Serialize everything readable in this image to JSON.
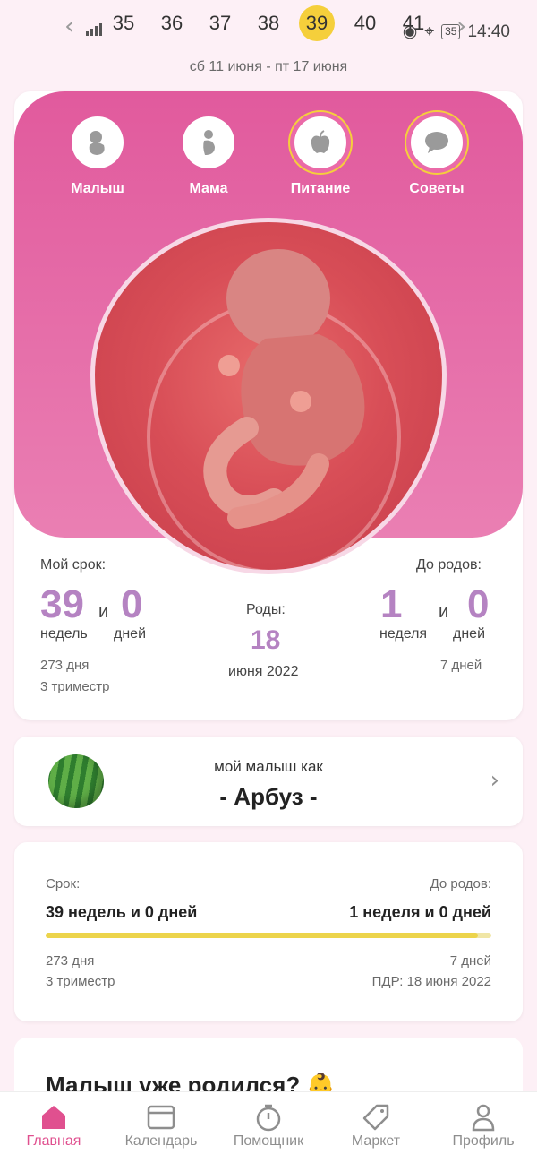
{
  "status_bar": {
    "time": "14:40",
    "battery": "35"
  },
  "week_selector": {
    "weeks": [
      "35",
      "36",
      "37",
      "38",
      "39",
      "40",
      "41"
    ],
    "active_week": "39",
    "date_range": "сб 11 июня - пт 17 июня"
  },
  "categories": [
    {
      "label": "Малыш",
      "icon": "baby-icon"
    },
    {
      "label": "Мама",
      "icon": "mom-icon"
    },
    {
      "label": "Питание",
      "icon": "apple-icon"
    },
    {
      "label": "Советы",
      "icon": "chat-icon"
    }
  ],
  "term": {
    "my_term_label": "Мой срок:",
    "weeks_value": "39",
    "and": "и",
    "days_value": "0",
    "weeks_unit": "недель",
    "days_unit": "дней",
    "total_days": "273 дня",
    "trimester": "3 триместр",
    "birth_label": "Роды:",
    "birth_day": "18",
    "birth_month": "июня 2022",
    "until_label": "До родов:",
    "until_weeks": "1",
    "until_and": "и",
    "until_days": "0",
    "until_weeks_unit": "неделя",
    "until_days_unit": "дней",
    "until_total": "7 дней"
  },
  "fruit": {
    "caption": "мой малыш как",
    "name": "- Арбуз -"
  },
  "summary": {
    "term_label": "Срок:",
    "term_value": "39 недель и 0 дней",
    "until_label": "До родов:",
    "until_value": "1 неделя и 0 дней",
    "progress": 0.97,
    "days": "273 дня",
    "trimester": "3 триместр",
    "days_left": "7 дней",
    "pdr": "ПДР: 18 июня 2022"
  },
  "born": {
    "title": "Малыш уже родился? 👶"
  },
  "nav": [
    {
      "label": "Главная",
      "icon": "home-icon",
      "active": true
    },
    {
      "label": "Календарь",
      "icon": "calendar-icon",
      "active": false
    },
    {
      "label": "Помощник",
      "icon": "timer-icon",
      "active": false
    },
    {
      "label": "Маркет",
      "icon": "tag-icon",
      "active": false
    },
    {
      "label": "Профиль",
      "icon": "profile-icon",
      "active": false
    }
  ],
  "colors": {
    "accent_pink": "#e15a9d",
    "accent_purple": "#b583c2",
    "accent_yellow": "#f5cf3b"
  }
}
